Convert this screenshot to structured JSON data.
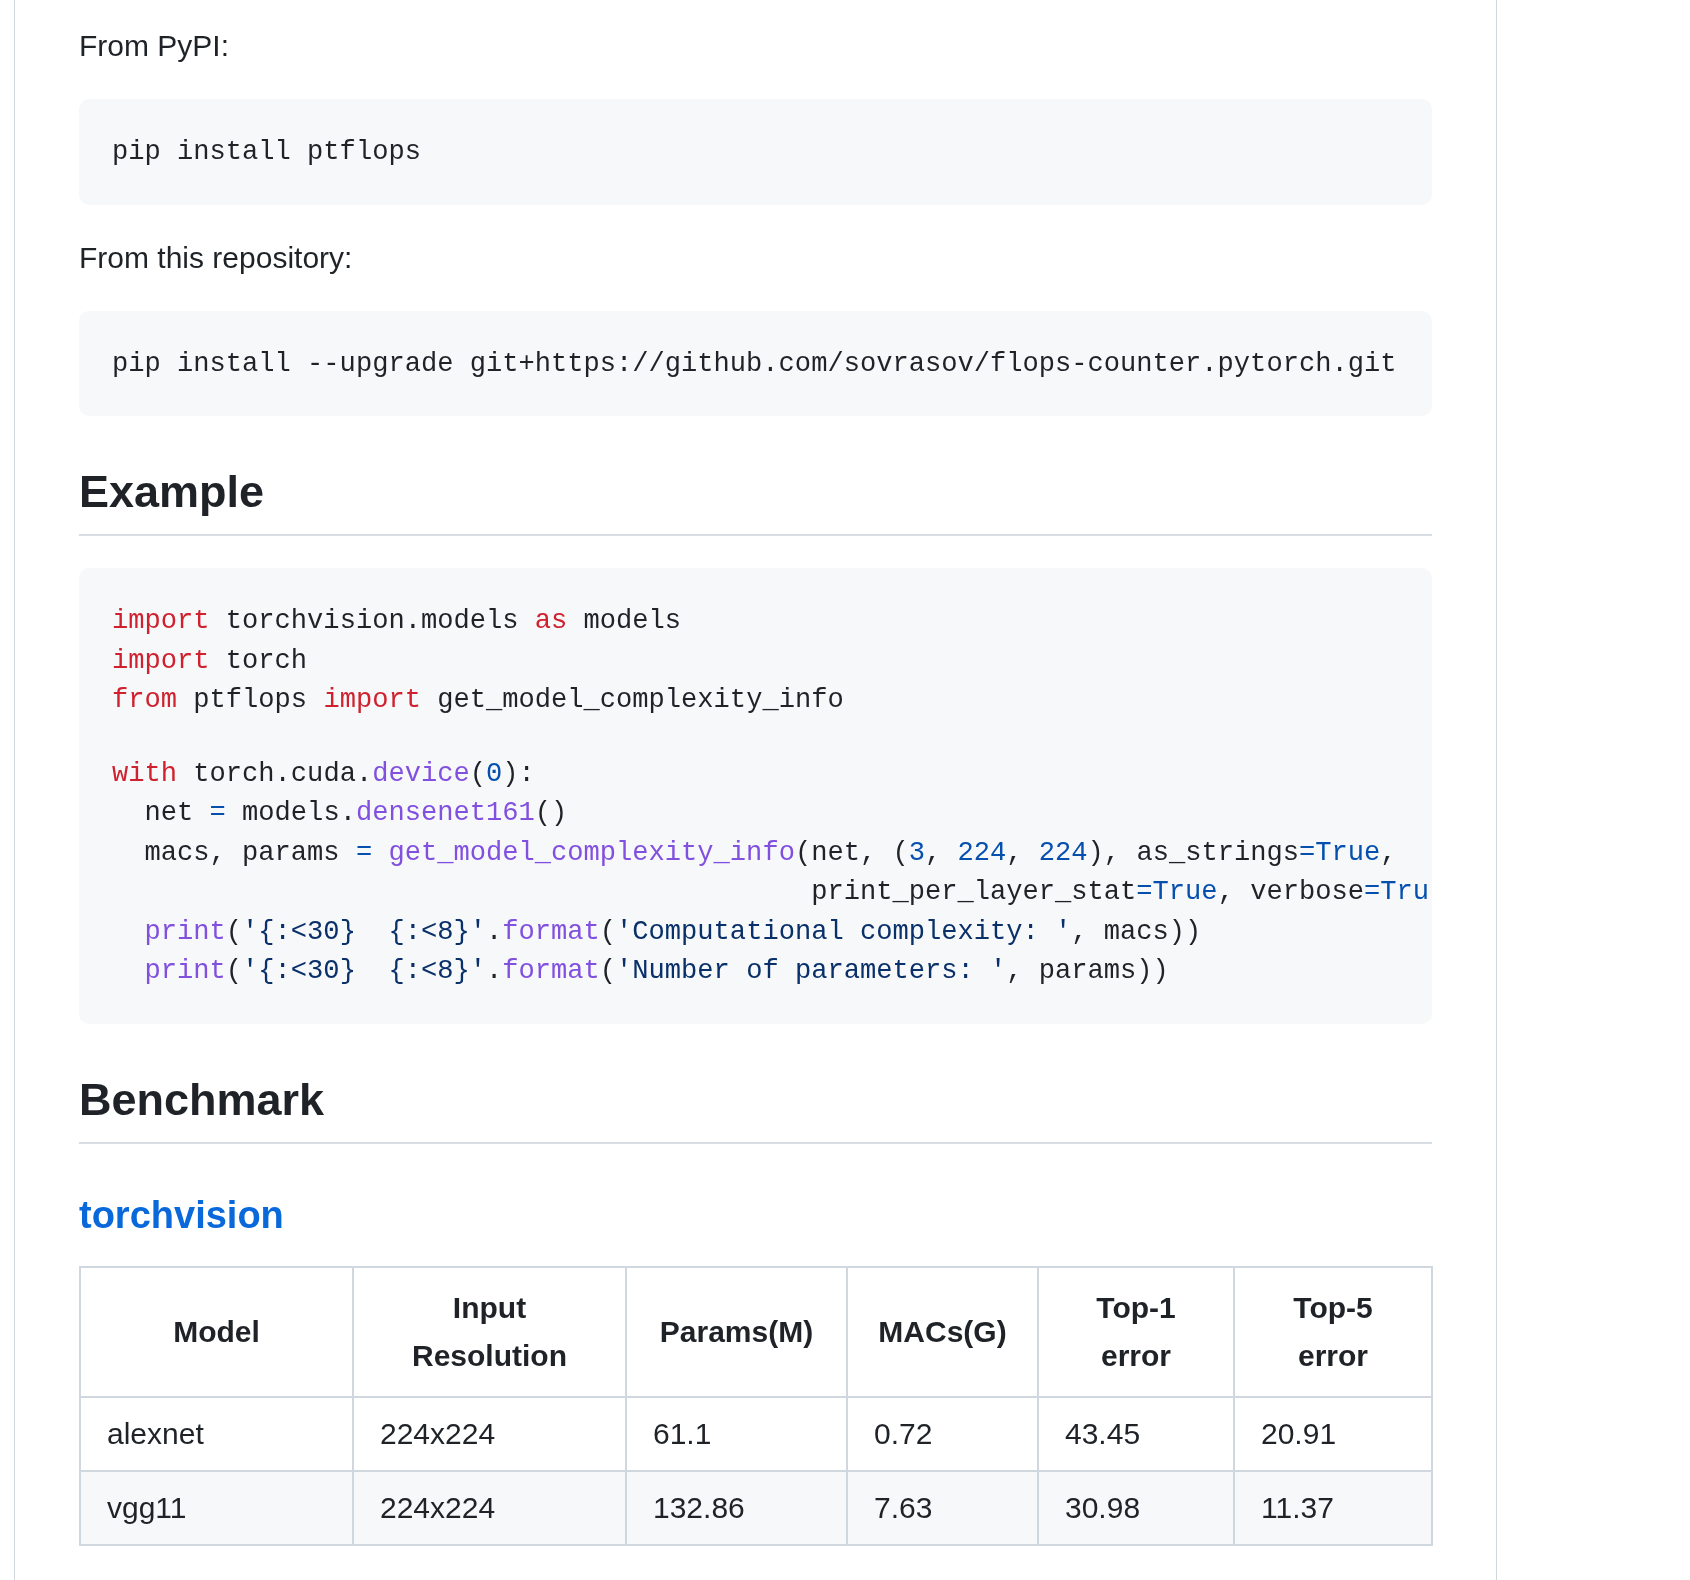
{
  "install": [
    {
      "label": "From PyPI:",
      "command": "pip install ptflops"
    },
    {
      "label": "From this repository:",
      "command": "pip install --upgrade git+https://github.com/sovrasov/flops-counter.pytorch.git"
    }
  ],
  "example": {
    "heading": "Example",
    "code_paragraphs": [
      {
        "lines": [
          {
            "tokens": [
              {
                "kind": "kw",
                "text": "import"
              },
              {
                "kind": "txt",
                "text": " torchvision.models "
              },
              {
                "kind": "kw",
                "text": "as"
              },
              {
                "kind": "txt",
                "text": " models"
              }
            ]
          },
          {
            "tokens": [
              {
                "kind": "kw",
                "text": "import"
              },
              {
                "kind": "txt",
                "text": " torch"
              }
            ]
          },
          {
            "tokens": [
              {
                "kind": "kw",
                "text": "from"
              },
              {
                "kind": "txt",
                "text": " ptflops "
              },
              {
                "kind": "kw",
                "text": "import"
              },
              {
                "kind": "txt",
                "text": " get_model_complexity_info"
              }
            ]
          }
        ]
      },
      {
        "lines": [
          {
            "tokens": [
              {
                "kind": "kw",
                "text": "with"
              },
              {
                "kind": "txt",
                "text": " torch.cuda."
              },
              {
                "kind": "fn",
                "text": "device"
              },
              {
                "kind": "txt",
                "text": "("
              },
              {
                "kind": "num",
                "text": "0"
              },
              {
                "kind": "txt",
                "text": "):"
              }
            ],
            "children": [
              {
                "tokens": [
                  {
                    "kind": "txt",
                    "text": "net "
                  },
                  {
                    "kind": "op",
                    "text": "="
                  },
                  {
                    "kind": "txt",
                    "text": " models."
                  },
                  {
                    "kind": "fn",
                    "text": "densenet161"
                  },
                  {
                    "kind": "txt",
                    "text": "()"
                  }
                ]
              },
              {
                "tokens": [
                  {
                    "kind": "txt",
                    "text": "macs, params "
                  },
                  {
                    "kind": "op",
                    "text": "= "
                  },
                  {
                    "kind": "fn",
                    "text": "get_model_complexity_info"
                  },
                  {
                    "kind": "txt",
                    "text": "(net, ("
                  },
                  {
                    "kind": "num",
                    "text": "3"
                  },
                  {
                    "kind": "txt",
                    "text": ", "
                  },
                  {
                    "kind": "num",
                    "text": "224"
                  },
                  {
                    "kind": "txt",
                    "text": ", "
                  },
                  {
                    "kind": "num",
                    "text": "224"
                  },
                  {
                    "kind": "txt",
                    "text": "), as_strings"
                  },
                  {
                    "kind": "op",
                    "text": "="
                  },
                  {
                    "kind": "num",
                    "text": "True"
                  },
                  {
                    "kind": "txt",
                    "text": ","
                  }
                ]
              },
              {
                "tokens": [
                  {
                    "kind": "txt",
                    "text": "                                         print_per_layer_stat"
                  },
                  {
                    "kind": "op",
                    "text": "="
                  },
                  {
                    "kind": "num",
                    "text": "True"
                  },
                  {
                    "kind": "txt",
                    "text": ", verbose"
                  },
                  {
                    "kind": "op",
                    "text": "="
                  },
                  {
                    "kind": "num",
                    "text": "Tru"
                  }
                ]
              },
              {
                "tokens": [
                  {
                    "kind": "fn",
                    "text": "print"
                  },
                  {
                    "kind": "txt",
                    "text": "("
                  },
                  {
                    "kind": "str",
                    "text": "'{:<30}  {:<8}'"
                  },
                  {
                    "kind": "txt",
                    "text": "."
                  },
                  {
                    "kind": "fn",
                    "text": "format"
                  },
                  {
                    "kind": "txt",
                    "text": "("
                  },
                  {
                    "kind": "str",
                    "text": "'Computational complexity: '"
                  },
                  {
                    "kind": "txt",
                    "text": ", macs))"
                  }
                ]
              },
              {
                "tokens": [
                  {
                    "kind": "fn",
                    "text": "print"
                  },
                  {
                    "kind": "txt",
                    "text": "("
                  },
                  {
                    "kind": "str",
                    "text": "'{:<30}  {:<8}'"
                  },
                  {
                    "kind": "txt",
                    "text": "."
                  },
                  {
                    "kind": "fn",
                    "text": "format"
                  },
                  {
                    "kind": "txt",
                    "text": "("
                  },
                  {
                    "kind": "str",
                    "text": "'Number of parameters: '"
                  },
                  {
                    "kind": "txt",
                    "text": ", params))"
                  }
                ]
              }
            ]
          }
        ]
      }
    ]
  },
  "benchmark": {
    "heading": "Benchmark",
    "subheading": "torchvision",
    "table": {
      "columns": [
        "Model",
        "Input Resolution",
        "Params(M)",
        "MACs(G)",
        "Top-1 error",
        "Top-5 error"
      ],
      "rows": [
        [
          "alexnet",
          "224x224",
          "61.1",
          "0.72",
          "43.45",
          "20.91"
        ],
        [
          "vgg11",
          "224x224",
          "132.86",
          "7.63",
          "30.98",
          "11.37"
        ]
      ]
    }
  }
}
